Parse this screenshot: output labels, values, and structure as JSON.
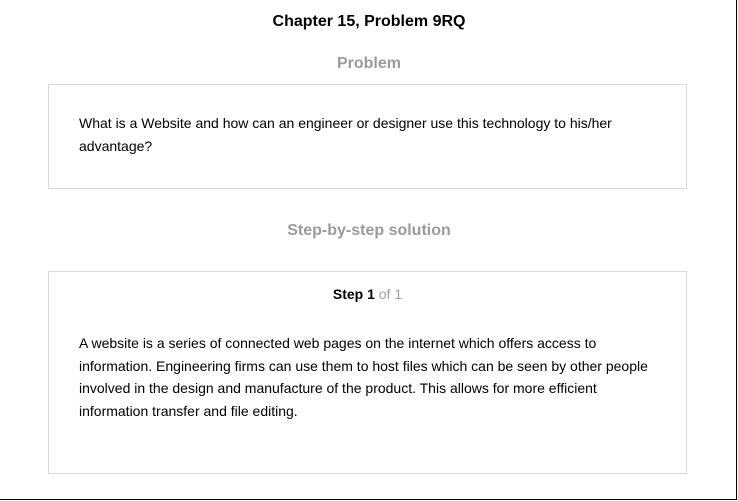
{
  "title": "Chapter 15, Problem 9RQ",
  "problem": {
    "heading": "Problem",
    "text": "What is a Website and how can an engineer or designer use this technology to his/her advantage?"
  },
  "solution": {
    "heading": "Step-by-step solution",
    "step_word": "Step 1",
    "step_of": "of 1",
    "text": "A website is a series of connected web pages on the internet which offers access to information. Engineering firms can use them to host files which can be seen by other people involved in the design and manufacture of the product. This allows for more efficient information transfer and file editing."
  },
  "colors": {
    "heading_gray": "#9b9b9b",
    "box_border": "#d9d9d9",
    "step_of_gray": "#a0a0a0"
  }
}
